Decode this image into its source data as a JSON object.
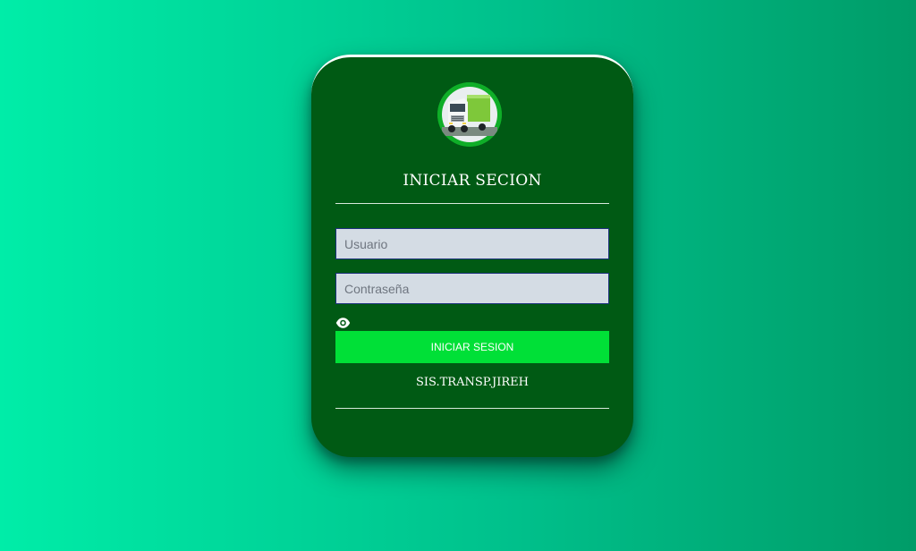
{
  "login": {
    "logo_icon": "truck-logo-icon",
    "title": "INICIAR SECION",
    "username_placeholder": "Usuario",
    "password_placeholder": "Contraseña",
    "show_password_icon": "eye-icon",
    "submit_label": "INICIAR SESION",
    "footer_text": "SIS.TRANSP.JIREH"
  },
  "colors": {
    "background_start": "#00eda8",
    "background_end": "#009c68",
    "card": "#005a14",
    "input_bg": "#d4dce4",
    "input_border": "#1a2f7a",
    "button": "#00e037",
    "logo_ring": "#0fae28"
  }
}
